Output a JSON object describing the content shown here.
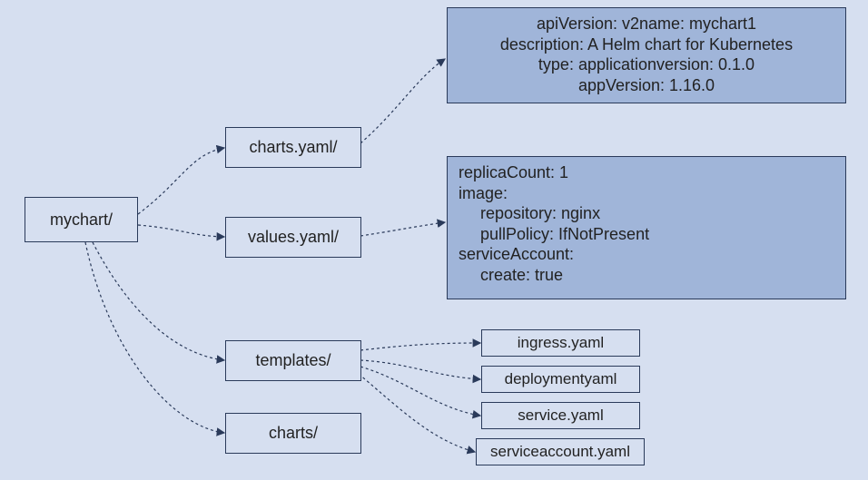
{
  "root": {
    "label": "mychart/"
  },
  "nodes": {
    "charts_yaml": "charts.yaml/",
    "values_yaml": "values.yaml/",
    "templates": "templates/",
    "charts": "charts/"
  },
  "files": {
    "ingress": "ingress.yaml",
    "deployment": "deploymentyaml",
    "service": "service.yaml",
    "serviceaccount": "serviceaccount.yaml"
  },
  "chart_yaml_panel": {
    "line1": "apiVersion: v2name: mychart1",
    "line2": "description: A Helm chart for Kubernetes",
    "line3": "type: applicationversion: 0.1.0",
    "line4": "appVersion: 1.16.0"
  },
  "values_yaml_panel": {
    "line1": "replicaCount: 1",
    "line2": "image:",
    "line3": "repository: nginx",
    "line4": "pullPolicy: IfNotPresent",
    "line5": "serviceAccount:",
    "line6": "create: true"
  }
}
